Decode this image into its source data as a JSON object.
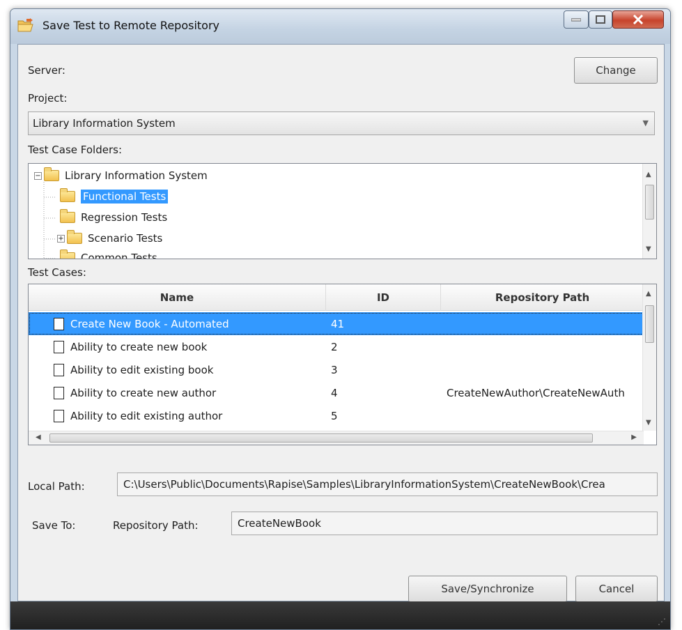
{
  "window": {
    "title": "Save Test to Remote Repository",
    "controls": {
      "minimize_icon": "minimize-icon",
      "maximize_icon": "maximize-icon",
      "close_icon": "close-icon"
    }
  },
  "server": {
    "label": "Server:",
    "change_button": "Change"
  },
  "project": {
    "label": "Project:",
    "selected": "Library Information System"
  },
  "folders": {
    "label": "Test Case Folders:",
    "root": "Library Information System",
    "items": [
      "Functional Tests",
      "Regression Tests",
      "Scenario Tests",
      "Common Tests"
    ],
    "selected": "Functional Tests"
  },
  "test_cases": {
    "label": "Test Cases:",
    "columns": [
      "Name",
      "ID",
      "Repository Path"
    ],
    "rows": [
      {
        "name": "Create New Book - Automated",
        "id": "41",
        "path": ""
      },
      {
        "name": "Ability to create new book",
        "id": "2",
        "path": ""
      },
      {
        "name": "Ability to edit existing book",
        "id": "3",
        "path": ""
      },
      {
        "name": "Ability to create new author",
        "id": "4",
        "path": "CreateNewAuthor\\CreateNewAuth"
      },
      {
        "name": "Ability to edit existing author",
        "id": "5",
        "path": ""
      }
    ],
    "selected_row": 0
  },
  "local_path": {
    "label": "Local Path:",
    "value": "C:\\Users\\Public\\Documents\\Rapise\\Samples\\LibraryInformationSystem\\CreateNewBook\\Crea"
  },
  "save_to": {
    "label": "Save To:",
    "repo_label": "Repository Path:",
    "repo_value": "CreateNewBook"
  },
  "buttons": {
    "save": "Save/Synchronize",
    "cancel": "Cancel"
  },
  "colors": {
    "selection": "#3399ff",
    "dialog_bg": "#f0f0f0",
    "frame": "#c9d7e6"
  }
}
